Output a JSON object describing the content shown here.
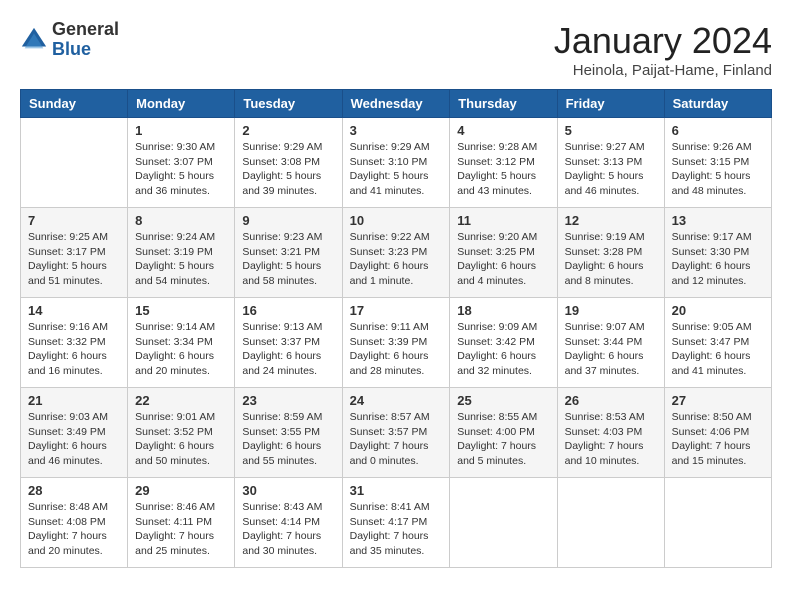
{
  "header": {
    "logo_general": "General",
    "logo_blue": "Blue",
    "month_title": "January 2024",
    "subtitle": "Heinola, Paijat-Hame, Finland"
  },
  "days_of_week": [
    "Sunday",
    "Monday",
    "Tuesday",
    "Wednesday",
    "Thursday",
    "Friday",
    "Saturday"
  ],
  "weeks": [
    [
      {
        "day": "",
        "sunrise": "",
        "sunset": "",
        "daylight": ""
      },
      {
        "day": "1",
        "sunrise": "Sunrise: 9:30 AM",
        "sunset": "Sunset: 3:07 PM",
        "daylight": "Daylight: 5 hours and 36 minutes."
      },
      {
        "day": "2",
        "sunrise": "Sunrise: 9:29 AM",
        "sunset": "Sunset: 3:08 PM",
        "daylight": "Daylight: 5 hours and 39 minutes."
      },
      {
        "day": "3",
        "sunrise": "Sunrise: 9:29 AM",
        "sunset": "Sunset: 3:10 PM",
        "daylight": "Daylight: 5 hours and 41 minutes."
      },
      {
        "day": "4",
        "sunrise": "Sunrise: 9:28 AM",
        "sunset": "Sunset: 3:12 PM",
        "daylight": "Daylight: 5 hours and 43 minutes."
      },
      {
        "day": "5",
        "sunrise": "Sunrise: 9:27 AM",
        "sunset": "Sunset: 3:13 PM",
        "daylight": "Daylight: 5 hours and 46 minutes."
      },
      {
        "day": "6",
        "sunrise": "Sunrise: 9:26 AM",
        "sunset": "Sunset: 3:15 PM",
        "daylight": "Daylight: 5 hours and 48 minutes."
      }
    ],
    [
      {
        "day": "7",
        "sunrise": "Sunrise: 9:25 AM",
        "sunset": "Sunset: 3:17 PM",
        "daylight": "Daylight: 5 hours and 51 minutes."
      },
      {
        "day": "8",
        "sunrise": "Sunrise: 9:24 AM",
        "sunset": "Sunset: 3:19 PM",
        "daylight": "Daylight: 5 hours and 54 minutes."
      },
      {
        "day": "9",
        "sunrise": "Sunrise: 9:23 AM",
        "sunset": "Sunset: 3:21 PM",
        "daylight": "Daylight: 5 hours and 58 minutes."
      },
      {
        "day": "10",
        "sunrise": "Sunrise: 9:22 AM",
        "sunset": "Sunset: 3:23 PM",
        "daylight": "Daylight: 6 hours and 1 minute."
      },
      {
        "day": "11",
        "sunrise": "Sunrise: 9:20 AM",
        "sunset": "Sunset: 3:25 PM",
        "daylight": "Daylight: 6 hours and 4 minutes."
      },
      {
        "day": "12",
        "sunrise": "Sunrise: 9:19 AM",
        "sunset": "Sunset: 3:28 PM",
        "daylight": "Daylight: 6 hours and 8 minutes."
      },
      {
        "day": "13",
        "sunrise": "Sunrise: 9:17 AM",
        "sunset": "Sunset: 3:30 PM",
        "daylight": "Daylight: 6 hours and 12 minutes."
      }
    ],
    [
      {
        "day": "14",
        "sunrise": "Sunrise: 9:16 AM",
        "sunset": "Sunset: 3:32 PM",
        "daylight": "Daylight: 6 hours and 16 minutes."
      },
      {
        "day": "15",
        "sunrise": "Sunrise: 9:14 AM",
        "sunset": "Sunset: 3:34 PM",
        "daylight": "Daylight: 6 hours and 20 minutes."
      },
      {
        "day": "16",
        "sunrise": "Sunrise: 9:13 AM",
        "sunset": "Sunset: 3:37 PM",
        "daylight": "Daylight: 6 hours and 24 minutes."
      },
      {
        "day": "17",
        "sunrise": "Sunrise: 9:11 AM",
        "sunset": "Sunset: 3:39 PM",
        "daylight": "Daylight: 6 hours and 28 minutes."
      },
      {
        "day": "18",
        "sunrise": "Sunrise: 9:09 AM",
        "sunset": "Sunset: 3:42 PM",
        "daylight": "Daylight: 6 hours and 32 minutes."
      },
      {
        "day": "19",
        "sunrise": "Sunrise: 9:07 AM",
        "sunset": "Sunset: 3:44 PM",
        "daylight": "Daylight: 6 hours and 37 minutes."
      },
      {
        "day": "20",
        "sunrise": "Sunrise: 9:05 AM",
        "sunset": "Sunset: 3:47 PM",
        "daylight": "Daylight: 6 hours and 41 minutes."
      }
    ],
    [
      {
        "day": "21",
        "sunrise": "Sunrise: 9:03 AM",
        "sunset": "Sunset: 3:49 PM",
        "daylight": "Daylight: 6 hours and 46 minutes."
      },
      {
        "day": "22",
        "sunrise": "Sunrise: 9:01 AM",
        "sunset": "Sunset: 3:52 PM",
        "daylight": "Daylight: 6 hours and 50 minutes."
      },
      {
        "day": "23",
        "sunrise": "Sunrise: 8:59 AM",
        "sunset": "Sunset: 3:55 PM",
        "daylight": "Daylight: 6 hours and 55 minutes."
      },
      {
        "day": "24",
        "sunrise": "Sunrise: 8:57 AM",
        "sunset": "Sunset: 3:57 PM",
        "daylight": "Daylight: 7 hours and 0 minutes."
      },
      {
        "day": "25",
        "sunrise": "Sunrise: 8:55 AM",
        "sunset": "Sunset: 4:00 PM",
        "daylight": "Daylight: 7 hours and 5 minutes."
      },
      {
        "day": "26",
        "sunrise": "Sunrise: 8:53 AM",
        "sunset": "Sunset: 4:03 PM",
        "daylight": "Daylight: 7 hours and 10 minutes."
      },
      {
        "day": "27",
        "sunrise": "Sunrise: 8:50 AM",
        "sunset": "Sunset: 4:06 PM",
        "daylight": "Daylight: 7 hours and 15 minutes."
      }
    ],
    [
      {
        "day": "28",
        "sunrise": "Sunrise: 8:48 AM",
        "sunset": "Sunset: 4:08 PM",
        "daylight": "Daylight: 7 hours and 20 minutes."
      },
      {
        "day": "29",
        "sunrise": "Sunrise: 8:46 AM",
        "sunset": "Sunset: 4:11 PM",
        "daylight": "Daylight: 7 hours and 25 minutes."
      },
      {
        "day": "30",
        "sunrise": "Sunrise: 8:43 AM",
        "sunset": "Sunset: 4:14 PM",
        "daylight": "Daylight: 7 hours and 30 minutes."
      },
      {
        "day": "31",
        "sunrise": "Sunrise: 8:41 AM",
        "sunset": "Sunset: 4:17 PM",
        "daylight": "Daylight: 7 hours and 35 minutes."
      },
      {
        "day": "",
        "sunrise": "",
        "sunset": "",
        "daylight": ""
      },
      {
        "day": "",
        "sunrise": "",
        "sunset": "",
        "daylight": ""
      },
      {
        "day": "",
        "sunrise": "",
        "sunset": "",
        "daylight": ""
      }
    ]
  ]
}
